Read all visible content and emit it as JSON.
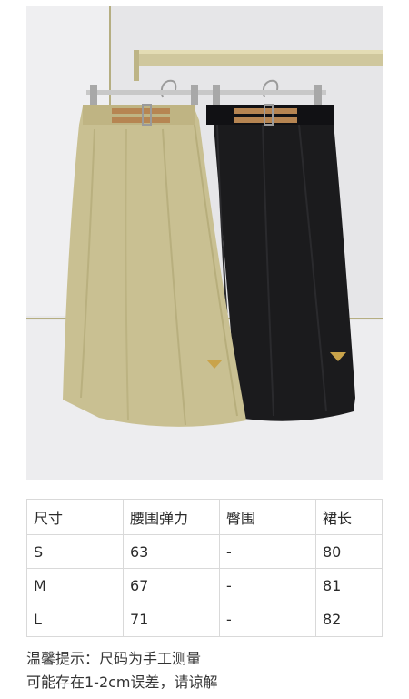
{
  "product": {
    "image_description": "",
    "image_alt": ""
  },
  "size_table": {
    "headers": [
      "尺寸",
      "腰围弹力",
      "臀围",
      "裙长"
    ],
    "rows": [
      [
        "S",
        "63",
        "-",
        "80"
      ],
      [
        "M",
        "67",
        "-",
        "81"
      ],
      [
        "L",
        "71",
        "-",
        "82"
      ]
    ]
  },
  "notes": {
    "line1": "温馨提示：尺码为手工测量",
    "line2": "可能存在1-2cm误差，请谅解"
  },
  "colors": {
    "khaki": "#c9c092",
    "black": "#1b1b1d",
    "belt": "#b68552",
    "hardware": "#c9a34a",
    "border": "#d9d9d9"
  }
}
